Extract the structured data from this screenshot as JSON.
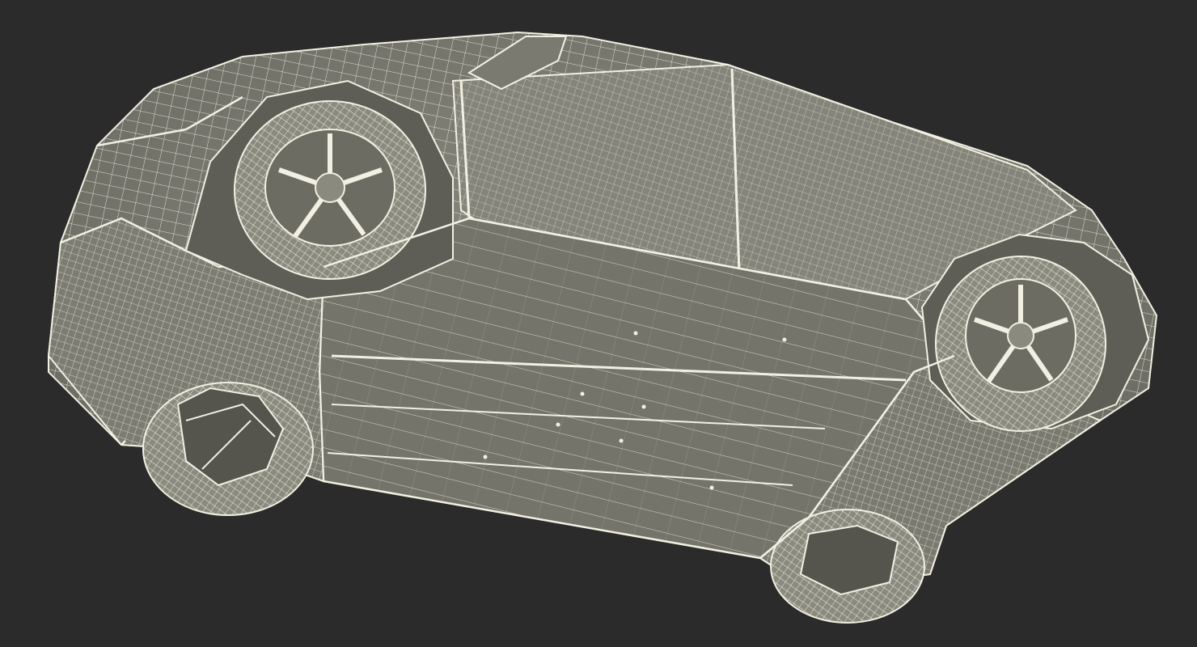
{
  "scene": {
    "subject": "car-underbody-wireframe",
    "background_color": "#2b2b2b",
    "mesh_fill_color": "#7b7b70",
    "mesh_fill_dark": "#5f5f57",
    "mesh_line_color": "#f2f0e2",
    "wheel_fill_color": "#8a8a7e"
  }
}
